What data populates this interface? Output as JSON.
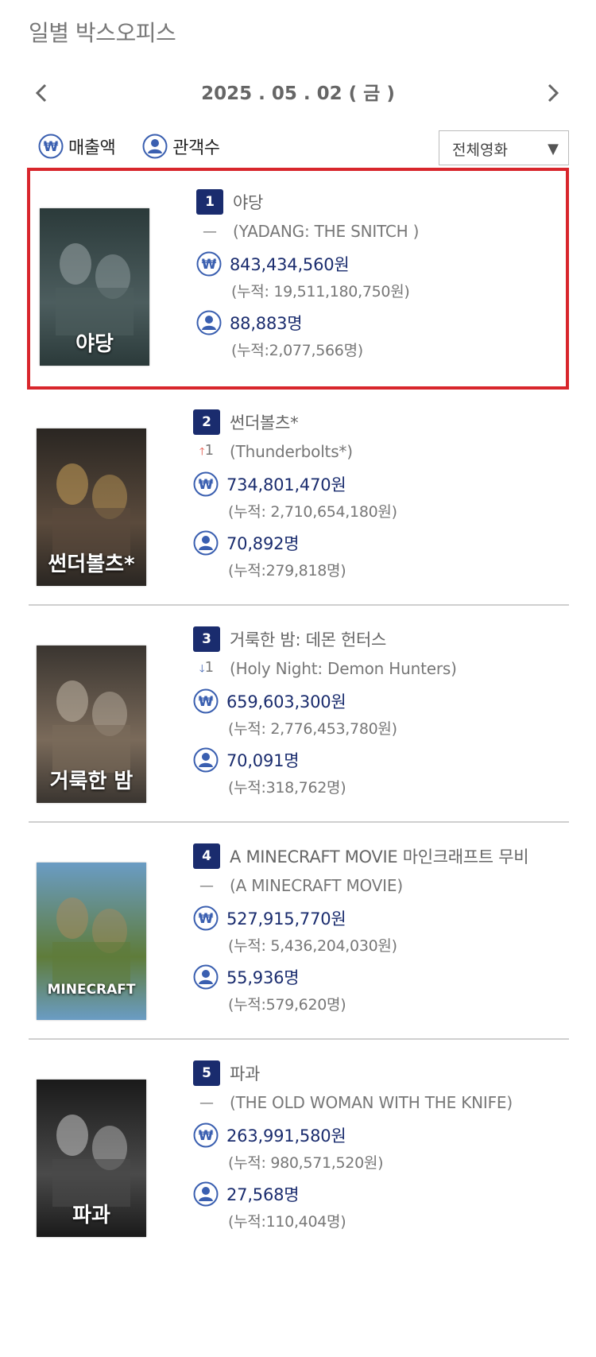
{
  "header": {
    "title": "일별 박스오피스"
  },
  "date_nav": {
    "date": "2025 . 05 . 02 ( 금 )"
  },
  "legend": {
    "sales_label": "매출액",
    "audience_label": "관객수"
  },
  "filter": {
    "selected": "전체영화"
  },
  "colors": {
    "navy": "#1a2c6e",
    "highlight": "#d8262c",
    "up_arrow": "#e04a3c",
    "down_arrow": "#3a5fb0"
  },
  "movies": [
    {
      "rank": "1",
      "title_ko": "야당",
      "change": "—",
      "change_dir": "none",
      "title_en": "(YADANG: THE SNITCH )",
      "sales": "843,434,560원",
      "sales_cum": "(누적: 19,511,180,750원)",
      "audience": "88,883명",
      "audience_cum": "(누적:2,077,566명)",
      "poster_text": "야당",
      "highlighted": true
    },
    {
      "rank": "2",
      "title_ko": "썬더볼츠*",
      "change": "1",
      "change_dir": "up",
      "title_en": "(Thunderbolts*)",
      "sales": "734,801,470원",
      "sales_cum": "(누적: 2,710,654,180원)",
      "audience": "70,892명",
      "audience_cum": "(누적:279,818명)",
      "poster_text": "썬더볼츠*",
      "highlighted": false
    },
    {
      "rank": "3",
      "title_ko": "거룩한 밤: 데몬 헌터스",
      "change": "1",
      "change_dir": "down",
      "title_en": "(Holy Night: Demon Hunters)",
      "sales": "659,603,300원",
      "sales_cum": "(누적: 2,776,453,780원)",
      "audience": "70,091명",
      "audience_cum": "(누적:318,762명)",
      "poster_text": "거룩한 밤",
      "highlighted": false
    },
    {
      "rank": "4",
      "title_ko": "A MINECRAFT MOVIE 마인크래프트 무비",
      "change": "—",
      "change_dir": "none",
      "title_en": "(A MINECRAFT MOVIE)",
      "sales": "527,915,770원",
      "sales_cum": "(누적: 5,436,204,030원)",
      "audience": "55,936명",
      "audience_cum": "(누적:579,620명)",
      "poster_text": "MINECRAFT",
      "highlighted": false
    },
    {
      "rank": "5",
      "title_ko": "파과",
      "change": "—",
      "change_dir": "none",
      "title_en": "(THE OLD WOMAN WITH THE KNIFE)",
      "sales": "263,991,580원",
      "sales_cum": "(누적: 980,571,520원)",
      "audience": "27,568명",
      "audience_cum": "(누적:110,404명)",
      "poster_text": "파과",
      "highlighted": false
    }
  ]
}
